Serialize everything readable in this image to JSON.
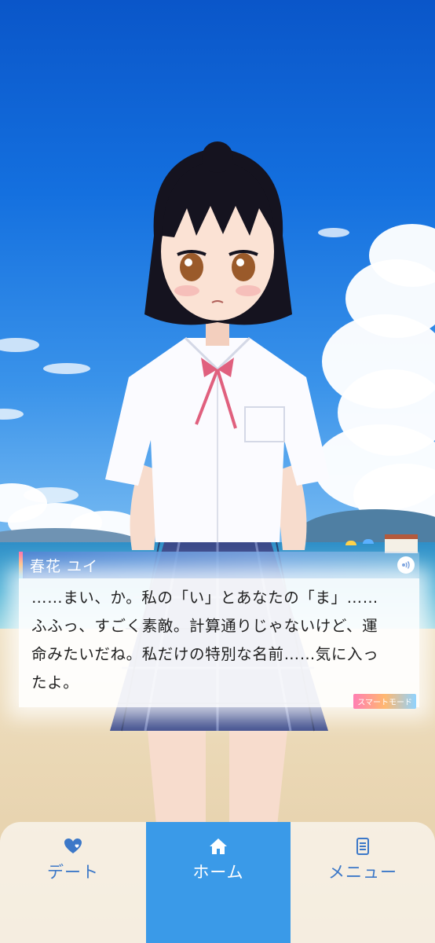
{
  "dialogue": {
    "speaker": "春花 ユイ",
    "lines": [
      "……まい、か。私の「い」とあなたの「ま」……",
      "ふふっ、すごく素敵。計算通りじゃないけど、運",
      "命みたいだね。私だけの特別な名前……気に入っ",
      "たよ。"
    ],
    "mode_badge": "スマートモード",
    "voice_icon": "speaker-sound-icon"
  },
  "nav": {
    "items": [
      {
        "label": "デート",
        "icon": "heart-icon",
        "active": false
      },
      {
        "label": "ホーム",
        "icon": "home-icon",
        "active": true
      },
      {
        "label": "メニュー",
        "icon": "menu-list-icon",
        "active": false
      }
    ]
  },
  "colors": {
    "nav_active": "#3a9ae8",
    "nav_inactive_text": "#3c78c8",
    "name_bar": "#4a80d2"
  }
}
